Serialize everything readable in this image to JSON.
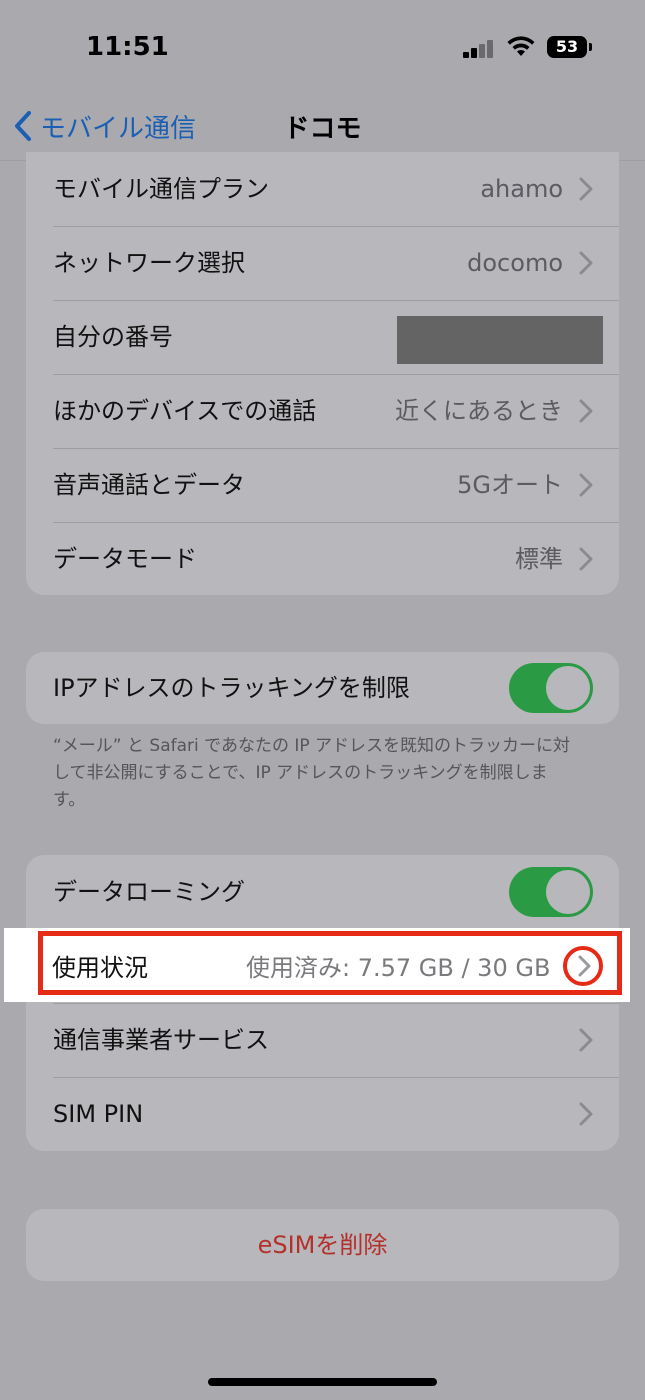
{
  "status_bar": {
    "time": "11:51",
    "battery": "53"
  },
  "nav": {
    "back_label": "モバイル通信",
    "title": "ドコモ"
  },
  "group1": [
    {
      "label": "モバイル通信プラン",
      "value": "ahamo"
    },
    {
      "label": "ネットワーク選択",
      "value": "docomo"
    },
    {
      "label": "自分の番号",
      "value": ""
    },
    {
      "label": "ほかのデバイスでの通話",
      "value": "近くにあるとき"
    },
    {
      "label": "音声通話とデータ",
      "value": "5Gオート"
    },
    {
      "label": "データモード",
      "value": "標準"
    }
  ],
  "ip_tracking": {
    "label": "IPアドレスのトラッキングを制限",
    "enabled": true
  },
  "footnote": "“メール” と Safari であなたの IP アドレスを既知のトラッカーに対して非公開にすることで、IP アドレスのトラッキングを制限します。",
  "group3": {
    "data_roaming": {
      "label": "データローミング",
      "enabled": true
    },
    "usage": {
      "label": "使用状況",
      "value": "使用済み: 7.57 GB / 30 GB"
    },
    "carrier_services": {
      "label": "通信事業者サービス"
    },
    "sim_pin": {
      "label": "SIM PIN"
    }
  },
  "delete_esim": {
    "label": "eSIMを削除"
  },
  "colors": {
    "accent": "#1b5fb5",
    "toggle_on": "#2a9a44",
    "destructive": "#b4302a",
    "highlight_border": "#e52a16"
  }
}
